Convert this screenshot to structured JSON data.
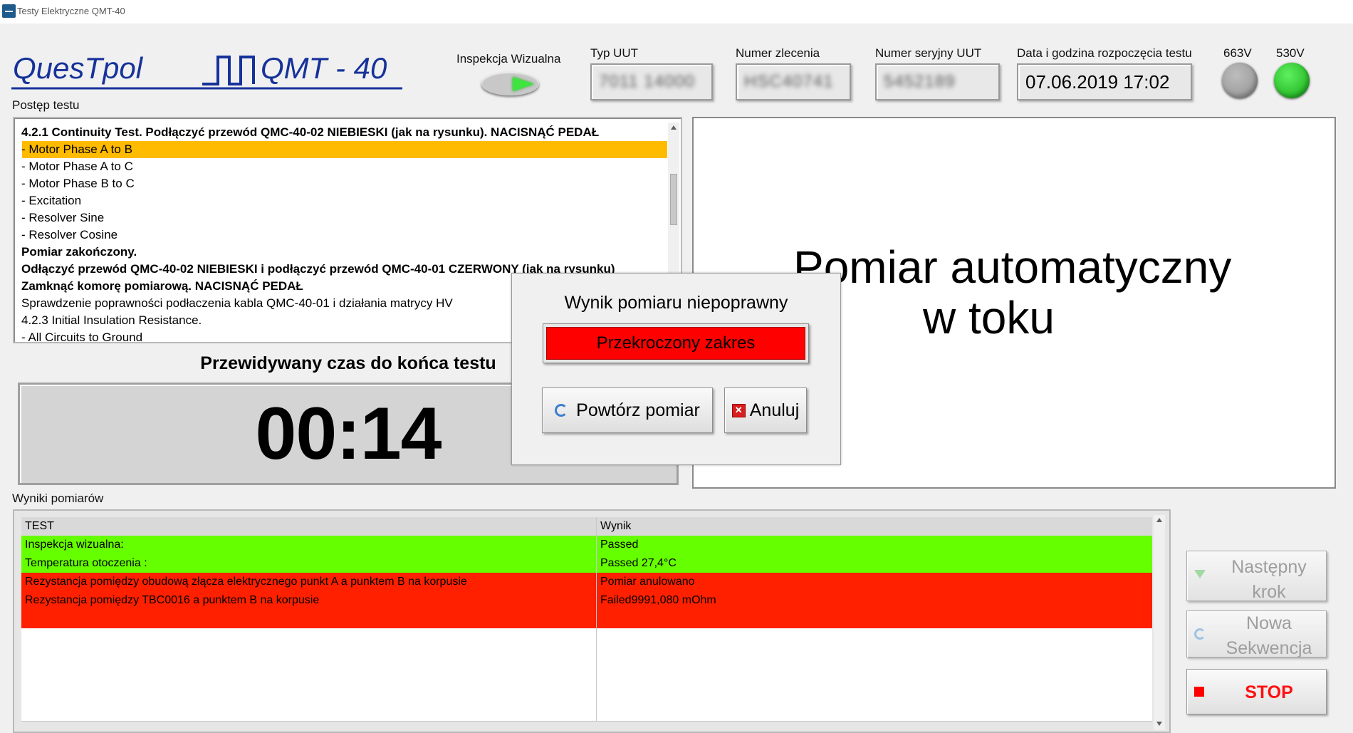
{
  "window": {
    "title": "Testy Elektryczne QMT-40"
  },
  "logo": {
    "brand": "QuesTpol",
    "model": "QMT - 40"
  },
  "header": {
    "visual_inspection_label": "Inspekcja Wizualna",
    "uut_type_label": "Typ UUT",
    "uut_type_value": "7011 14000",
    "order_number_label": "Numer zlecenia",
    "order_number_value": "HSC40741",
    "serial_label": "Numer seryjny UUT",
    "serial_value": "5452189",
    "start_datetime_label": "Data i godzina rozpoczęcia testu",
    "start_datetime_value": "07.06.2019 17:02",
    "led_663_label": "663V",
    "led_530_label": "530V"
  },
  "progress": {
    "label": "Postęp testu",
    "steps": [
      {
        "text": "4.2.1 Continuity Test. Podłączyć przewód QMC-40-02 NIEBIESKI (jak na rysunku). NACISNĄĆ PEDAŁ",
        "bold": true
      },
      {
        "text": "- Motor Phase A to B",
        "bold": false,
        "selected": true
      },
      {
        "text": "- Motor Phase A to C",
        "bold": false
      },
      {
        "text": "- Motor Phase B to C",
        "bold": false
      },
      {
        "text": "- Excitation",
        "bold": false
      },
      {
        "text": "- Resolver Sine",
        "bold": false
      },
      {
        "text": "- Resolver Cosine",
        "bold": false
      },
      {
        "text": "Pomiar zakończony.",
        "bold": true
      },
      {
        "text": "Odłączyć przewód QMC-40-02 NIEBIESKI i podłączyć przewód QMC-40-01 CZERWONY (jak na rysunku)",
        "bold": true
      },
      {
        "text": "Zamknąć komorę pomiarową. NACISNĄĆ PEDAŁ",
        "bold": true
      },
      {
        "text": "Sprawdzenie poprawności podłaczenia kabla QMC-40-01 i działania matrycy HV",
        "bold": false
      },
      {
        "text": "4.2.3 Initial Insulation Resistance.",
        "bold": false
      },
      {
        "text": "- All Circuits to Ground",
        "bold": false
      }
    ]
  },
  "timer": {
    "label": "Przewidywany czas do końca testu",
    "value": "00:14"
  },
  "display": {
    "line1": "Pomiar automatyczny",
    "line2": "w toku"
  },
  "dialog": {
    "title": "Wynik pomiaru niepoprawny",
    "error": "Przekroczony zakres",
    "retry_label": "Powtórz pomiar",
    "cancel_label": "Anuluj"
  },
  "results": {
    "label": "Wyniki pomiarów",
    "columns": [
      "TEST",
      "Wynik"
    ],
    "rows": [
      {
        "test": "Inspekcja wizualna:",
        "result": "Passed",
        "color": "#66ff00"
      },
      {
        "test": "Temperatura otoczenia :",
        "result": "Passed 27,4°C",
        "color": "#66ff00"
      },
      {
        "test": "Rezystancja pomiędzy obudową złącza elektrycznego punkt A a punktem B na korpusie",
        "result": "Pomiar anulowano",
        "color": "#ff2000"
      },
      {
        "test": "Rezystancja pomiędzy TBC0016 a punktem B na korpusie",
        "result": "Failed9991,080 mOhm",
        "color": "#ff2000"
      },
      {
        "test": "",
        "result": "",
        "color": "#ff2000"
      },
      {
        "test": "",
        "result": "",
        "color": "#ffffff"
      },
      {
        "test": "",
        "result": "",
        "color": "#ffffff"
      },
      {
        "test": "",
        "result": "",
        "color": "#ffffff"
      },
      {
        "test": "",
        "result": "",
        "color": "#ffffff"
      },
      {
        "test": "",
        "result": "",
        "color": "#ffffff"
      }
    ]
  },
  "buttons": {
    "next_line1": "Następny",
    "next_line2": "krok",
    "new_line1": "Nowa",
    "new_line2": "Sekwencja",
    "stop": "STOP"
  },
  "colors": {
    "selected": "#ffbb00",
    "pass": "#66ff00",
    "fail": "#ff2000",
    "error_red": "#ff0000",
    "led_green": "#1ec81e",
    "led_grey": "#a3a3a3",
    "logo_blue": "#16329a"
  }
}
